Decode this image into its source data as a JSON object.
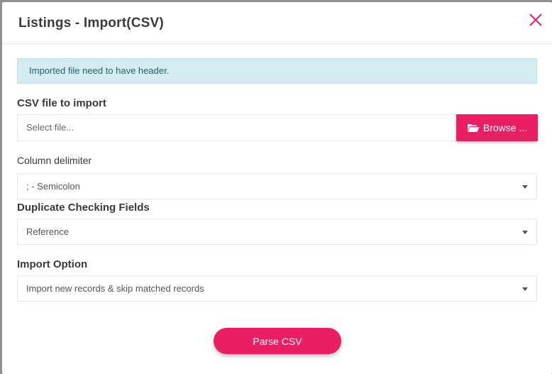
{
  "modal": {
    "title": "Listings - Import(CSV)"
  },
  "alert": {
    "text": "Imported file need to have header."
  },
  "csv_file": {
    "label": "CSV file to import",
    "placeholder": "Select file...",
    "browse_label": "Browse ..."
  },
  "delimiter": {
    "label": "Column delimiter",
    "selected": "; - Semicolon"
  },
  "duplicate": {
    "label": "Duplicate Checking Fields",
    "selected": "Reference"
  },
  "import_option": {
    "label": "Import Option",
    "selected": "Import new records & skip matched records"
  },
  "actions": {
    "parse_label": "Parse CSV"
  },
  "icons": {
    "close": "close-icon",
    "folder": "folder-open-icon",
    "dropdown": "chevron-down-icon"
  },
  "colors": {
    "accent": "#e91e63",
    "alert_bg": "#d4ecf1",
    "alert_text": "#24616f"
  }
}
